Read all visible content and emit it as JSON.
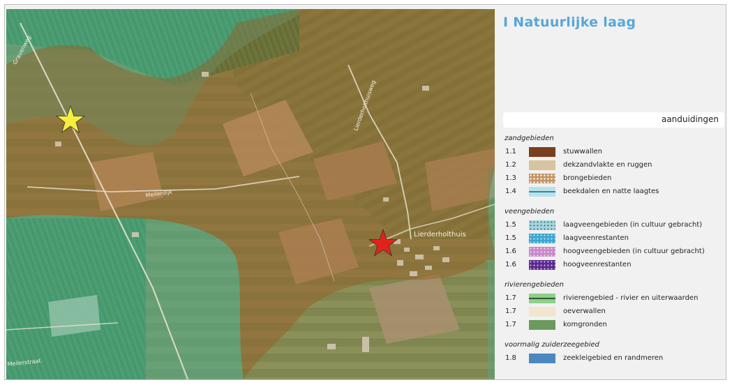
{
  "panel": {
    "title": "I Natuurlijke laag",
    "tab_label": "aanduidingen"
  },
  "legend": {
    "groups": [
      {
        "title": "zandgebieden",
        "items": [
          {
            "code": "1.1",
            "label": "stuwwallen",
            "color": "#7a3f1c",
            "pattern": "solid"
          },
          {
            "code": "1.2",
            "label": "dekzandvlakte en ruggen",
            "color": "#d8c3a0",
            "pattern": "solid"
          },
          {
            "code": "1.3",
            "label": "brongebieden",
            "color": "#c49566",
            "pattern": "dots-white"
          },
          {
            "code": "1.4",
            "label": "beekdalen en natte laagtes",
            "color": "#b9e1ea",
            "pattern": "line-teal"
          }
        ]
      },
      {
        "title": "veengebieden",
        "items": [
          {
            "code": "1.5",
            "label": "laagveengebieden (in cultuur gebracht)",
            "color": "#a6d5dc",
            "pattern": "dots-dark"
          },
          {
            "code": "1.5",
            "label": "laagveenrestanten",
            "color": "#3aa7cf",
            "pattern": "dots-light"
          },
          {
            "code": "1.6",
            "label": "hoogveengebieden (in cultuur gebracht)",
            "color": "#c988c9",
            "pattern": "dots-light"
          },
          {
            "code": "1.6",
            "label": "hoogveenrestanten",
            "color": "#5b2a8f",
            "pattern": "dots-light"
          }
        ]
      },
      {
        "title": "rivierengebieden",
        "items": [
          {
            "code": "1.7",
            "label": "rivierengebied - rivier en uiterwaarden",
            "color": "#8fcf8a",
            "pattern": "line-dark"
          },
          {
            "code": "1.7",
            "label": "oeverwallen",
            "color": "#f2e6cf",
            "pattern": "solid"
          },
          {
            "code": "1.7",
            "label": "komgronden",
            "color": "#6c9a5e",
            "pattern": "solid"
          }
        ]
      },
      {
        "title": "voormalig zuiderzeegebied",
        "items": [
          {
            "code": "1.8",
            "label": "zeekleigebied en randmeren",
            "color": "#4b88c2",
            "pattern": "solid"
          }
        ]
      }
    ]
  },
  "map": {
    "road_labels": [
      "Gravenweg",
      "Lierderholthuisweg",
      "Meilerdijk",
      "Meilerstraat"
    ],
    "place_labels": [
      "Lierderholthuis"
    ],
    "markers": [
      {
        "name": "yellow-star",
        "color": "#f5ee3c"
      },
      {
        "name": "red-star",
        "color": "#e3231b"
      }
    ],
    "overlay_colors": {
      "brown": "#9a5a22",
      "green": "#4fae8e"
    }
  }
}
